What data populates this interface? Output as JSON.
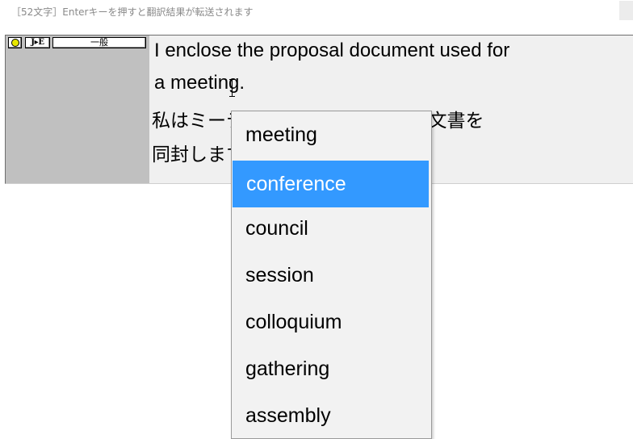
{
  "status_bar": {
    "text": "［52文字］Enterキーを押すと翻訳結果が転送されます"
  },
  "toolbar": {
    "direction_label": "J▸E",
    "category_label": "一般"
  },
  "editor": {
    "english_line_1": "I enclose the proposal document used for",
    "english_line_2": "a meeting.",
    "japanese_line_1": "私はミーティングで使われる提案文書を",
    "japanese_line_2": "同封します。"
  },
  "suggestions": {
    "selected_index": 1,
    "items": [
      "meeting",
      "conference",
      "council",
      "session",
      "colloquium",
      "gathering",
      "assembly"
    ]
  },
  "colors": {
    "selection": "#3399ff",
    "panel_bg": "#f0f0f0",
    "sidebar_bg": "#c0c0c0"
  }
}
